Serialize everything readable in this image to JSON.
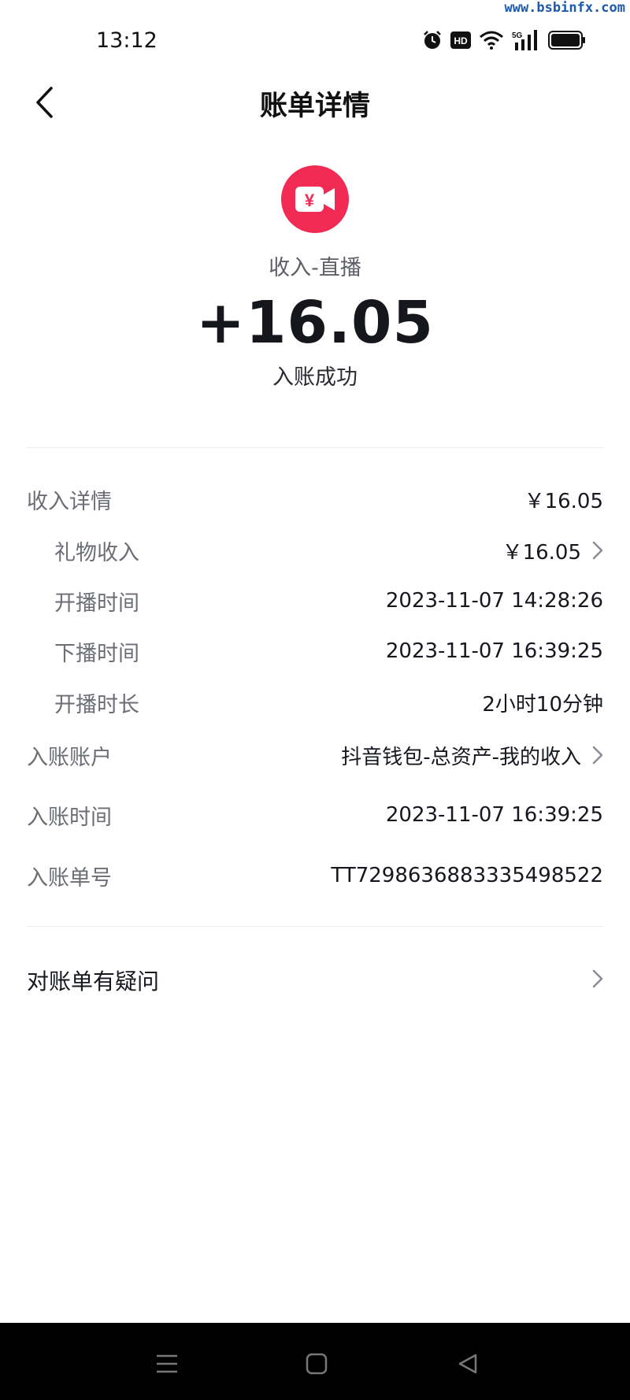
{
  "watermark": "www.bsbinfx.com",
  "status_bar": {
    "time": "13:12",
    "icons": [
      "alarm-icon",
      "hd-icon",
      "wifi-icon",
      "signal-5g-icon",
      "battery-icon"
    ],
    "hd_text": "HD",
    "network_text": "5G"
  },
  "nav": {
    "title": "账单详情"
  },
  "transaction": {
    "category": "收入-直播",
    "amount": "+16.05",
    "status": "入账成功",
    "icon_symbol": "¥",
    "icon_color": "#f22b55"
  },
  "details": [
    {
      "label": "收入详情",
      "value": "￥16.05",
      "sub": false,
      "chevron": false
    },
    {
      "label": "礼物收入",
      "value": "￥16.05",
      "sub": true,
      "chevron": true
    },
    {
      "label": "开播时间",
      "value": "2023-11-07 14:28:26",
      "sub": true,
      "chevron": false
    },
    {
      "label": "下播时间",
      "value": "2023-11-07 16:39:25",
      "sub": true,
      "chevron": false
    },
    {
      "label": "开播时长",
      "value": "2小时10分钟",
      "sub": true,
      "chevron": false
    },
    {
      "label": "入账账户",
      "value": "抖音钱包-总资产-我的收入",
      "sub": false,
      "chevron": true
    },
    {
      "label": "入账时间",
      "value": "2023-11-07 16:39:25",
      "sub": false,
      "chevron": false
    },
    {
      "label": "入账单号",
      "value": "TT7298636883335498522",
      "sub": false,
      "chevron": false
    }
  ],
  "help": {
    "label": "对账单有疑问"
  },
  "system_nav": [
    "menu-icon",
    "home-icon",
    "back-triangle-icon"
  ]
}
